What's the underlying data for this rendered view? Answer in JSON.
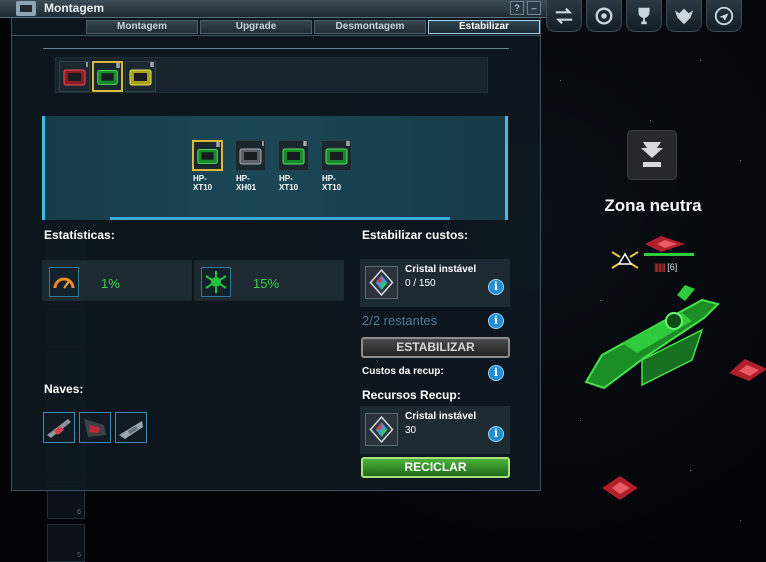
{
  "window": {
    "title": "Montagem",
    "tabs": [
      {
        "label": "Montagem",
        "active": false
      },
      {
        "label": "Upgrade",
        "active": false
      },
      {
        "label": "Desmontagem",
        "active": false
      },
      {
        "label": "Estabilizar",
        "active": true
      }
    ]
  },
  "inventory": {
    "items": [
      {
        "icon": "red-module-icon",
        "level": "I",
        "selected": false
      },
      {
        "icon": "green-module-icon",
        "level": "II",
        "selected": true
      },
      {
        "icon": "yellow-module-icon",
        "level": "II",
        "selected": false
      }
    ]
  },
  "stabilize_slots": [
    {
      "label": "HP-XT10",
      "level": "II",
      "selected": true
    },
    {
      "label": "HP-XH01",
      "level": "I",
      "selected": false
    },
    {
      "label": "HP-XT10",
      "level": "II",
      "selected": false
    },
    {
      "label": "HP-XT10",
      "level": "II",
      "selected": false
    }
  ],
  "stats": {
    "heading": "Estatísticas:",
    "items": [
      {
        "icon": "speedometer-icon",
        "value": "1%"
      },
      {
        "icon": "green-spider-icon",
        "value": "15%"
      }
    ]
  },
  "ships": {
    "heading": "Naves:",
    "items": [
      {
        "icon": "ship-1-icon"
      },
      {
        "icon": "ship-2-icon"
      },
      {
        "icon": "ship-3-icon"
      }
    ]
  },
  "stabilize": {
    "heading": "Estabilizar custos:",
    "cost_name": "Cristal instável",
    "cost_value": "0 / 150",
    "remaining": "2/2 restantes",
    "button": "ESTABILIZAR",
    "recup_costs_label": "Custos da recup:"
  },
  "recycle": {
    "heading": "Recursos Recup:",
    "resource_name": "Cristal instável",
    "resource_value": "30",
    "button": "RECICLAR"
  },
  "space": {
    "zone": "Zona neutra",
    "target_count": "[6]"
  },
  "topbar": {
    "icons": [
      "swap-icon",
      "gear-wheel-icon",
      "trophy-icon",
      "eagle-icon",
      "rocket-icon"
    ]
  },
  "background_list_numbers": [
    "6",
    "5"
  ],
  "colors": {
    "accent": "#49b9e6",
    "positive": "#2fd64a",
    "recycle": "#3f9e31",
    "selected": "#d8b93a"
  }
}
